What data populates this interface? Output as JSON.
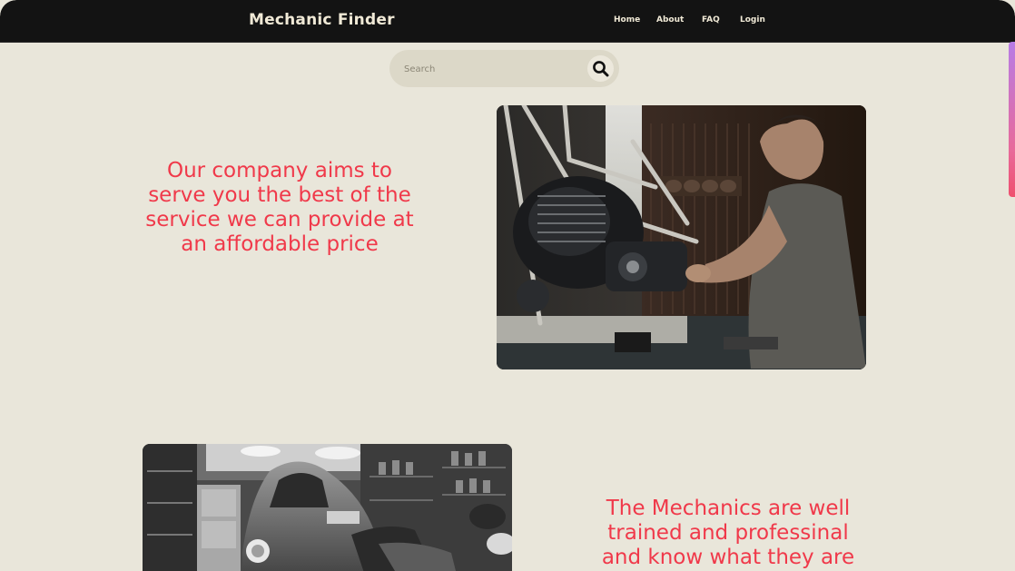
{
  "header": {
    "brand": "Mechanic Finder",
    "nav": {
      "home": "Home",
      "about": "About",
      "faq": "FAQ",
      "login": "Login"
    }
  },
  "search": {
    "placeholder": "Search",
    "button_icon": "search-icon"
  },
  "sections": [
    {
      "text": "Our company aims to serve you the best of the service we can provide at an affordable price",
      "image": "mechanic-working-on-motorcycle-engine-photo"
    },
    {
      "text": "The Mechanics are well trained and professinal and know what they are",
      "image": "mechanic-under-vintage-car-bw-photo"
    }
  ],
  "colors": {
    "navbar": "#131313",
    "background": "#e9e6da",
    "accent_text": "#f0394a",
    "brand_text": "#f0e9d6"
  }
}
